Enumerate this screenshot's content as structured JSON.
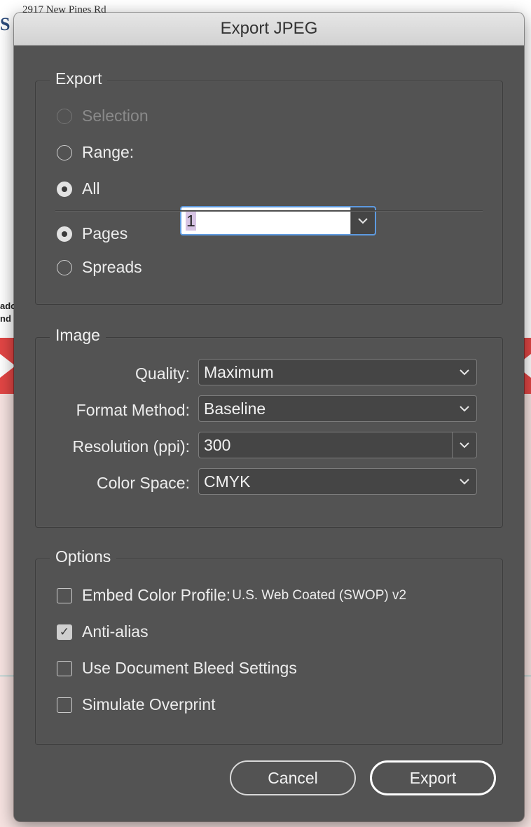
{
  "background": {
    "top_text": "2917 New Pines Rd",
    "logo_fragment": "S",
    "side_text_1": "ado",
    "side_text_2": "nd"
  },
  "dialog": {
    "title": "Export JPEG"
  },
  "export_group": {
    "title": "Export",
    "selection_label": "Selection",
    "range_label": "Range:",
    "range_value": "1",
    "all_label": "All",
    "pages_label": "Pages",
    "spreads_label": "Spreads"
  },
  "image_group": {
    "title": "Image",
    "quality_label": "Quality:",
    "quality_value": "Maximum",
    "format_label": "Format Method:",
    "format_value": "Baseline",
    "resolution_label": "Resolution (ppi):",
    "resolution_value": "300",
    "colorspace_label": "Color Space:",
    "colorspace_value": "CMYK"
  },
  "options_group": {
    "title": "Options",
    "embed_label": "Embed Color Profile:",
    "embed_profile": "U.S. Web Coated (SWOP) v2",
    "antialias_label": "Anti-alias",
    "bleed_label": "Use Document Bleed Settings",
    "overprint_label": "Simulate Overprint",
    "checkmark": "✓"
  },
  "buttons": {
    "cancel": "Cancel",
    "export": "Export"
  },
  "state": {
    "selection_enabled": false,
    "range_selected": "All",
    "export_as": "Pages",
    "embed_color_profile": false,
    "anti_alias": true,
    "use_bleed": false,
    "simulate_overprint": false
  },
  "colors": {
    "dialog_bg": "#535353",
    "focus_ring": "#5d9ae0",
    "text": "#ededed"
  },
  "icons": {
    "dropdown": "chevron-down-icon",
    "check": "checkmark-icon"
  }
}
